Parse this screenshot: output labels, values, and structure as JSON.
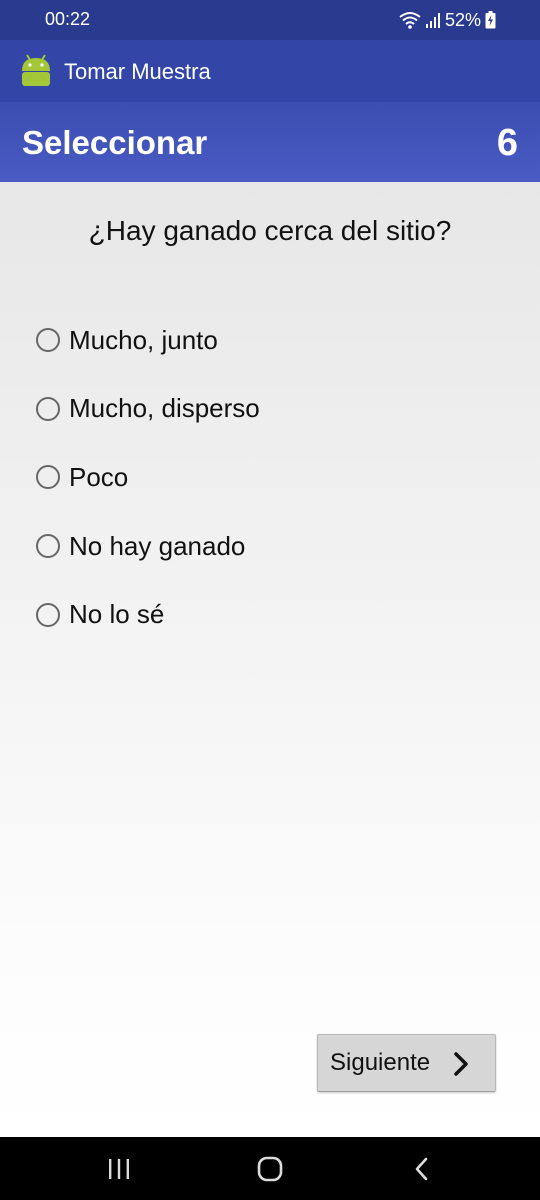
{
  "status_bar": {
    "time": "00:22",
    "battery": "52%",
    "icons": [
      "wifi-icon",
      "signal-icon",
      "battery-charging-icon"
    ]
  },
  "app_bar": {
    "title": "Tomar Muestra",
    "icon": "android-icon"
  },
  "section": {
    "title": "Seleccionar",
    "count": "6"
  },
  "question": "¿Hay ganado cerca del sitio?",
  "options": [
    {
      "label": "Mucho, junto",
      "selected": false
    },
    {
      "label": "Mucho, disperso",
      "selected": false
    },
    {
      "label": "Poco",
      "selected": false
    },
    {
      "label": "No hay ganado",
      "selected": false
    },
    {
      "label": "No lo sé",
      "selected": false
    }
  ],
  "next_button": {
    "label": "Siguiente",
    "icon": "chevron-right-icon"
  },
  "nav_bar": {
    "buttons": [
      "recents-icon",
      "home-icon",
      "back-icon"
    ]
  },
  "colors": {
    "status_bar": "#2a3a8e",
    "app_bar": "#3345a6",
    "section_header": "#4253b8",
    "android_green": "#a4c639"
  }
}
